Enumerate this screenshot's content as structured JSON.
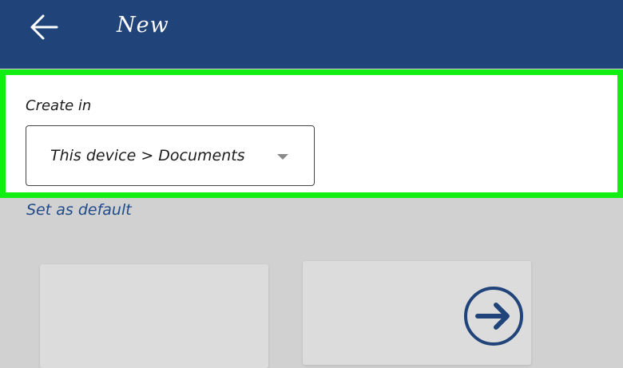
{
  "header": {
    "back_icon": "arrow-left-icon",
    "title": "New",
    "background": "#204479"
  },
  "create_section": {
    "label": "Create in",
    "location_value": "This device > Documents",
    "dropdown_icon": "caret-down-icon",
    "highlight_color": "#12ee12"
  },
  "set_default_link": "Set as default",
  "templates": {
    "cards": [
      {
        "icon": ""
      },
      {
        "icon": "arrow-right-circle-icon"
      }
    ]
  }
}
